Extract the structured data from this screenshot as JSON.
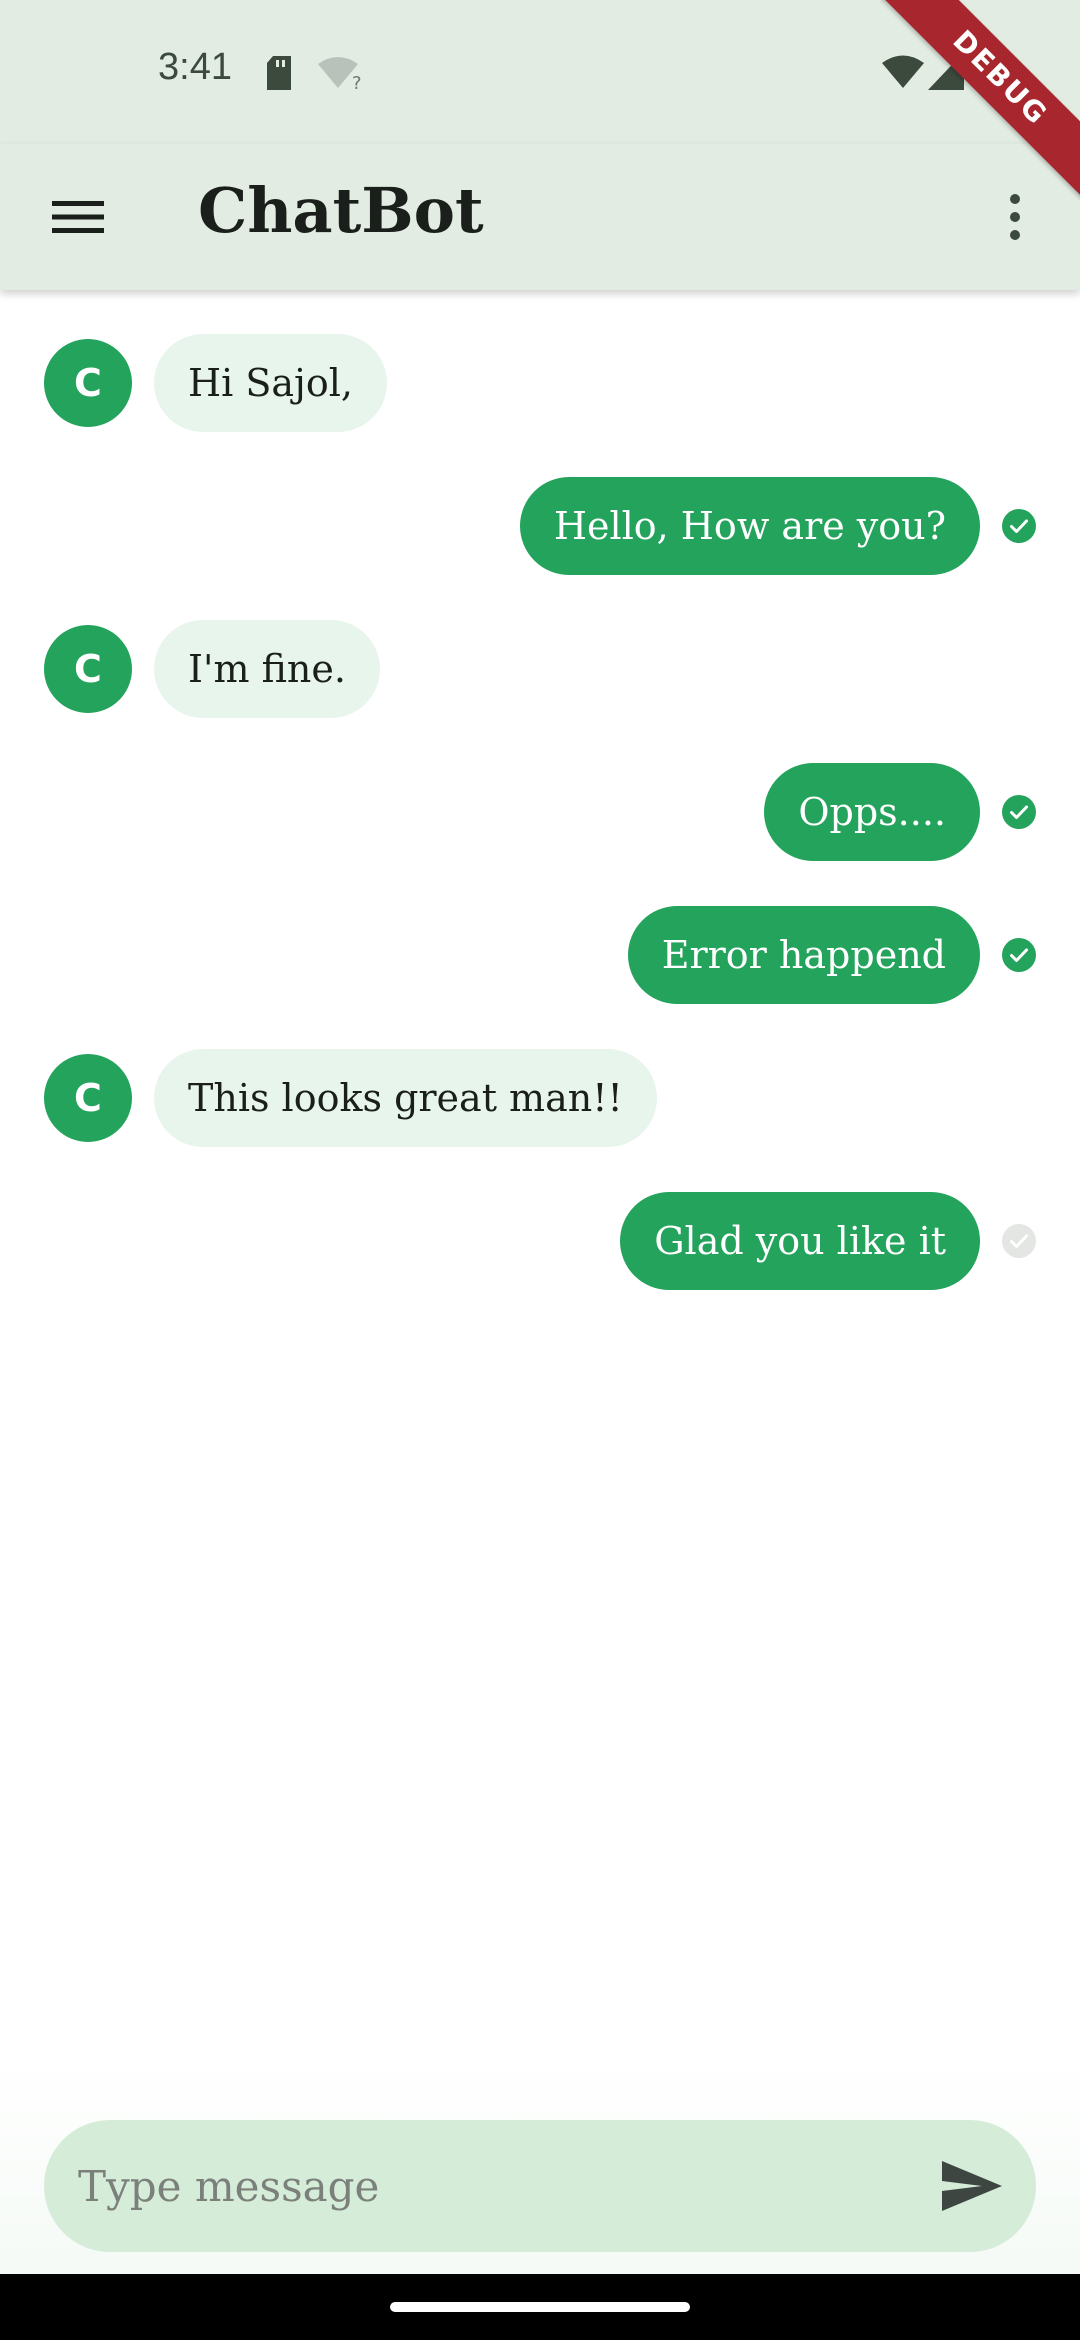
{
  "status_bar": {
    "time": "3:41"
  },
  "debug_banner": "DEBUG",
  "app_bar": {
    "title": "ChatBot",
    "menu_icon": "hamburger-menu-icon",
    "more_icon": "more-vert-icon"
  },
  "colors": {
    "accent": "#24a35c",
    "app_bar_bg": "#e2ece2",
    "incoming_bubble": "#e8f5ec",
    "input_bg": "#d5ecd9",
    "pending_check": "#e3e6e3"
  },
  "messages": [
    {
      "sender": "bot",
      "avatar": "C",
      "text": "Hi Sajol,"
    },
    {
      "sender": "user",
      "text": "Hello, How are you?",
      "status": "delivered"
    },
    {
      "sender": "bot",
      "avatar": "C",
      "text": "I'm fine."
    },
    {
      "sender": "user",
      "text": "Opps....",
      "status": "delivered"
    },
    {
      "sender": "user",
      "text": "Error happend",
      "status": "delivered"
    },
    {
      "sender": "bot",
      "avatar": "C",
      "text": "This looks great man!!"
    },
    {
      "sender": "user",
      "text": "Glad you like it",
      "status": "pending"
    }
  ],
  "composer": {
    "placeholder": "Type message",
    "value": "",
    "send_icon": "send-icon"
  }
}
